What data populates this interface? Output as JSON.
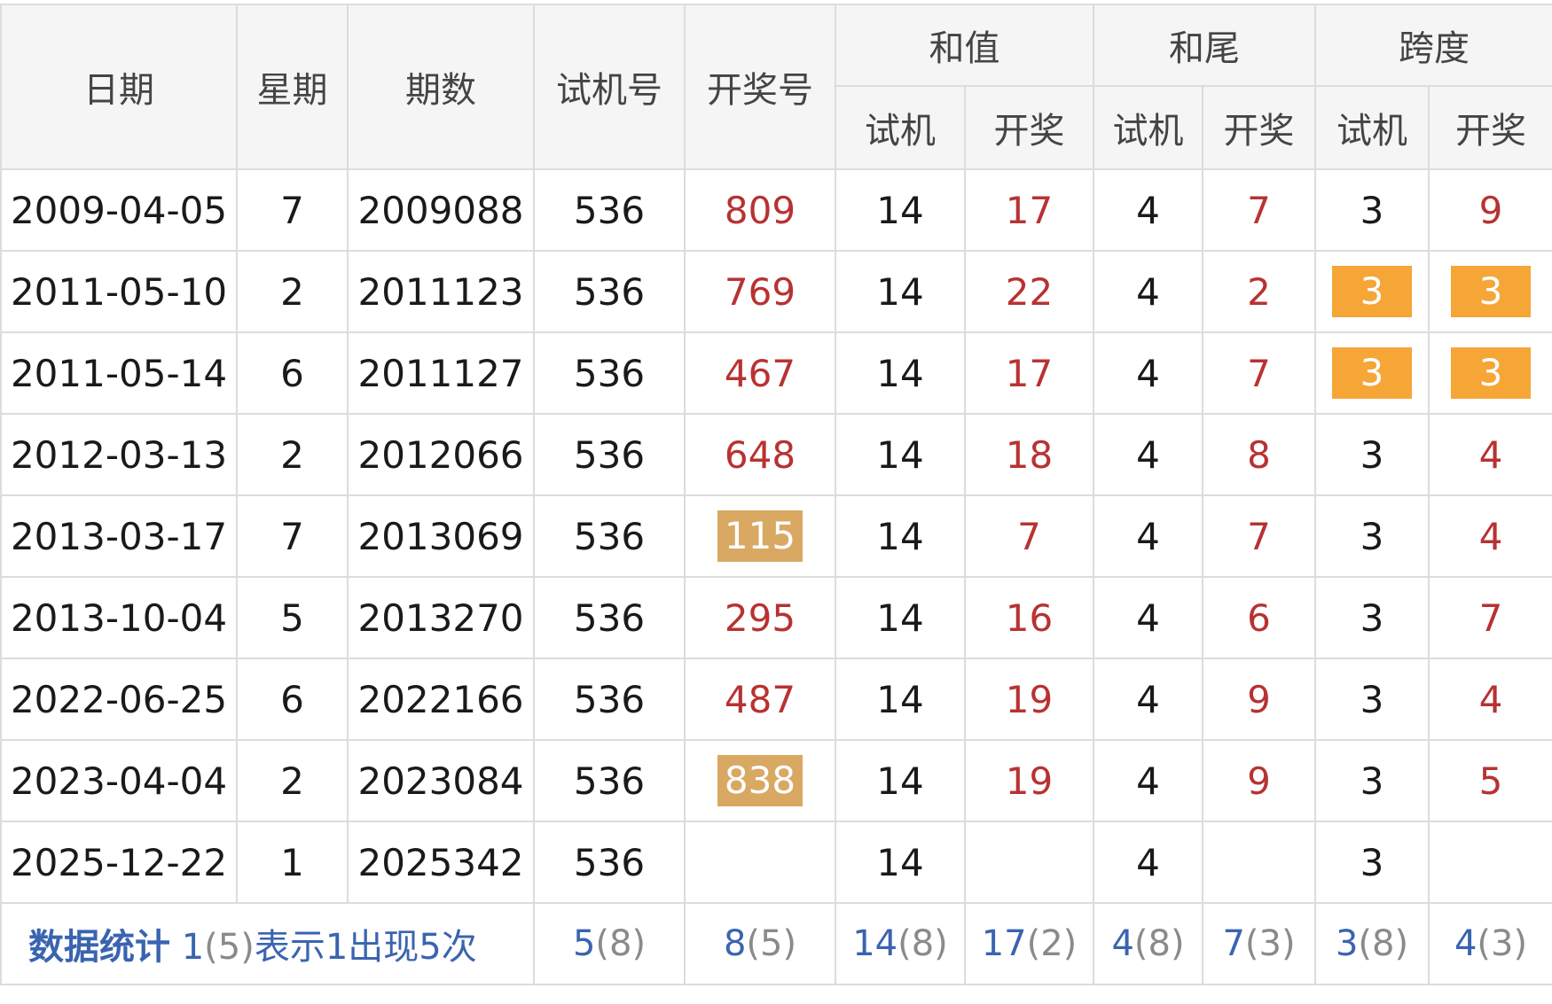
{
  "headers": {
    "date": "日期",
    "weekday": "星期",
    "issue": "期数",
    "trial_number": "试机号",
    "draw_number": "开奖号",
    "sum_group": "和值",
    "tail_group": "和尾",
    "span_group": "跨度",
    "sub_trial": "试机",
    "sub_draw": "开奖"
  },
  "rows": [
    {
      "date": "2009-04-05",
      "weekday": "7",
      "issue": "2009088",
      "trial": "536",
      "draw": "809",
      "sum_trial": "14",
      "sum_draw": "17",
      "tail_trial": "4",
      "tail_draw": "7",
      "span_trial": "3",
      "span_draw": "9"
    },
    {
      "date": "2011-05-10",
      "weekday": "2",
      "issue": "2011123",
      "trial": "536",
      "draw": "769",
      "sum_trial": "14",
      "sum_draw": "22",
      "tail_trial": "4",
      "tail_draw": "2",
      "span_trial": "3",
      "span_draw": "3"
    },
    {
      "date": "2011-05-14",
      "weekday": "6",
      "issue": "2011127",
      "trial": "536",
      "draw": "467",
      "sum_trial": "14",
      "sum_draw": "17",
      "tail_trial": "4",
      "tail_draw": "7",
      "span_trial": "3",
      "span_draw": "3"
    },
    {
      "date": "2012-03-13",
      "weekday": "2",
      "issue": "2012066",
      "trial": "536",
      "draw": "648",
      "sum_trial": "14",
      "sum_draw": "18",
      "tail_trial": "4",
      "tail_draw": "8",
      "span_trial": "3",
      "span_draw": "4"
    },
    {
      "date": "2013-03-17",
      "weekday": "7",
      "issue": "2013069",
      "trial": "536",
      "draw": "115",
      "sum_trial": "14",
      "sum_draw": "7",
      "tail_trial": "4",
      "tail_draw": "7",
      "span_trial": "3",
      "span_draw": "4"
    },
    {
      "date": "2013-10-04",
      "weekday": "5",
      "issue": "2013270",
      "trial": "536",
      "draw": "295",
      "sum_trial": "14",
      "sum_draw": "16",
      "tail_trial": "4",
      "tail_draw": "6",
      "span_trial": "3",
      "span_draw": "7"
    },
    {
      "date": "2022-06-25",
      "weekday": "6",
      "issue": "2022166",
      "trial": "536",
      "draw": "487",
      "sum_trial": "14",
      "sum_draw": "19",
      "tail_trial": "4",
      "tail_draw": "9",
      "span_trial": "3",
      "span_draw": "4"
    },
    {
      "date": "2023-04-04",
      "weekday": "2",
      "issue": "2023084",
      "trial": "536",
      "draw": "838",
      "sum_trial": "14",
      "sum_draw": "19",
      "tail_trial": "4",
      "tail_draw": "9",
      "span_trial": "3",
      "span_draw": "5"
    },
    {
      "date": "2025-12-22",
      "weekday": "1",
      "issue": "2025342",
      "trial": "536",
      "draw": "",
      "sum_trial": "14",
      "sum_draw": "",
      "tail_trial": "4",
      "tail_draw": "",
      "span_trial": "3",
      "span_draw": ""
    }
  ],
  "stats": {
    "link_label": "数据统计",
    "legend_value": "1",
    "legend_count": "(5)",
    "legend_text": "表示1出现5次",
    "trial_value": "5",
    "trial_count": "(8)",
    "draw_value": "8",
    "draw_count": "(5)",
    "sum_trial_value": "14",
    "sum_trial_count": "(8)",
    "sum_draw_value": "17",
    "sum_draw_count": "(2)",
    "tail_trial_value": "4",
    "tail_trial_count": "(8)",
    "tail_draw_value": "7",
    "tail_draw_count": "(3)",
    "span_trial_value": "3",
    "span_trial_count": "(8)",
    "span_draw_value": "4",
    "span_draw_count": "(3)"
  },
  "colors": {
    "draw_text": "#b83232",
    "highlight_tan": "#d9a862",
    "highlight_orange": "#f5a637",
    "stat_link": "#3a64b0",
    "header_bg": "#f5f5f5",
    "border": "#dcdcdc"
  }
}
